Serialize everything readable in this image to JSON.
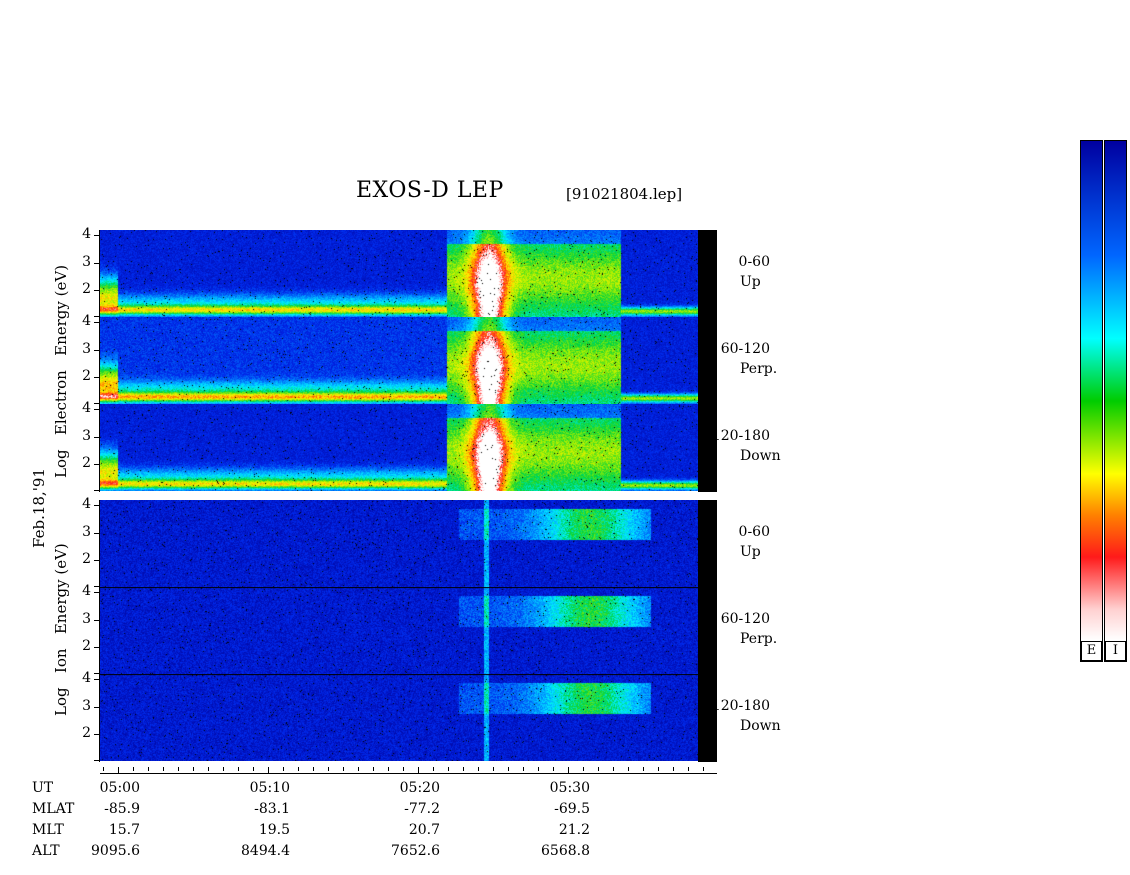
{
  "header": {
    "title": "EXOS-D LEP",
    "filename": "[91021804.lep]"
  },
  "date_label": "Feb.18,'91",
  "electron_label": [
    "Log",
    "Electron",
    "Energy",
    "(eV)"
  ],
  "ion_label": [
    "Log",
    "Ion",
    "Energy",
    "(eV)"
  ],
  "pitch_labels": [
    {
      "range": "0-60",
      "dir": "Up"
    },
    {
      "range": "60-120",
      "dir": "Perp."
    },
    {
      "range": "120-180",
      "dir": "Down"
    },
    {
      "range": "0-60",
      "dir": "Up"
    },
    {
      "range": "60-120",
      "dir": "Perp."
    },
    {
      "range": "120-180",
      "dir": "Down"
    }
  ],
  "colorbar_labels": [
    "E",
    "I"
  ],
  "colors": {
    "scale": [
      "#ffffff",
      "#ff1a1a",
      "#ff8000",
      "#ffff00",
      "#00cc00",
      "#00ffff",
      "#0066ff",
      "#0000a0"
    ]
  },
  "table": {
    "row_labels": [
      "UT",
      "MLAT",
      "MLT",
      "ALT"
    ],
    "columns": [
      {
        "UT": "05:00",
        "MLAT": "-85.9",
        "MLT": "15.7",
        "ALT": "9095.6"
      },
      {
        "UT": "05:10",
        "MLAT": "-83.1",
        "MLT": "19.5",
        "ALT": "8494.4"
      },
      {
        "UT": "05:20",
        "MLAT": "-77.2",
        "MLT": "20.7",
        "ALT": "7652.6"
      },
      {
        "UT": "05:30",
        "MLAT": "-69.5",
        "MLT": "21.2",
        "ALT": "6568.8"
      }
    ]
  },
  "chart_data": {
    "type": "heatmap",
    "title": "EXOS-D LEP",
    "xlabel": "UT",
    "x_ticks": [
      "05:00",
      "05:10",
      "05:20",
      "05:30"
    ],
    "ylabel": "Log Energy (eV)",
    "y_ticks": [
      "2",
      "3",
      "4"
    ],
    "ylim": [
      1,
      4.2
    ],
    "panels": [
      {
        "species": "Electron",
        "pitch": "0-60",
        "dir": "Up"
      },
      {
        "species": "Electron",
        "pitch": "60-120",
        "dir": "Perp."
      },
      {
        "species": "Electron",
        "pitch": "120-180",
        "dir": "Down"
      },
      {
        "species": "Ion",
        "pitch": "0-60",
        "dir": "Up"
      },
      {
        "species": "Ion",
        "pitch": "60-120",
        "dir": "Perp."
      },
      {
        "species": "Ion",
        "pitch": "120-180",
        "dir": "Down"
      }
    ]
  }
}
